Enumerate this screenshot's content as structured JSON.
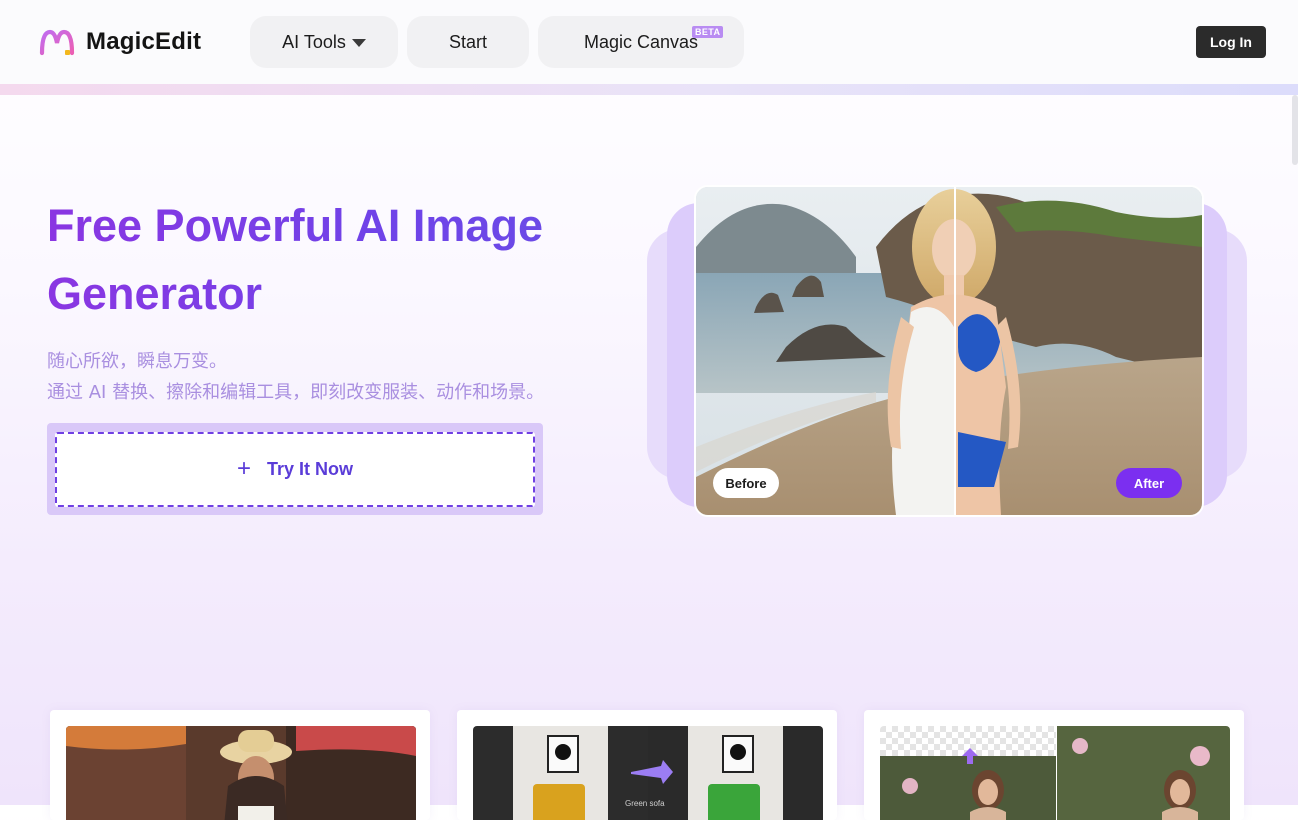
{
  "header": {
    "logo_text": "MagicEdit",
    "nav": {
      "ai_tools": "AI Tools",
      "start": "Start",
      "magic_canvas": "Magic Canvas",
      "beta": "BETA"
    },
    "login": "Log In"
  },
  "hero": {
    "title": "Free Powerful AI Image Generator",
    "subtitle_line1": "随心所欲，瞬息万变。",
    "subtitle_line2": "通过 AI 替换、擦除和编辑工具，即刻改变服装、动作和场景。",
    "cta": "Try It Now",
    "before_label": "Before",
    "after_label": "After"
  },
  "cards": {
    "card2_caption": "Green sofa"
  },
  "colors": {
    "title_gradient_start": "#8a36e2",
    "title_gradient_end": "#6a4ce6",
    "accent": "#7b2ff0",
    "login_bg": "#2b2b2b"
  }
}
